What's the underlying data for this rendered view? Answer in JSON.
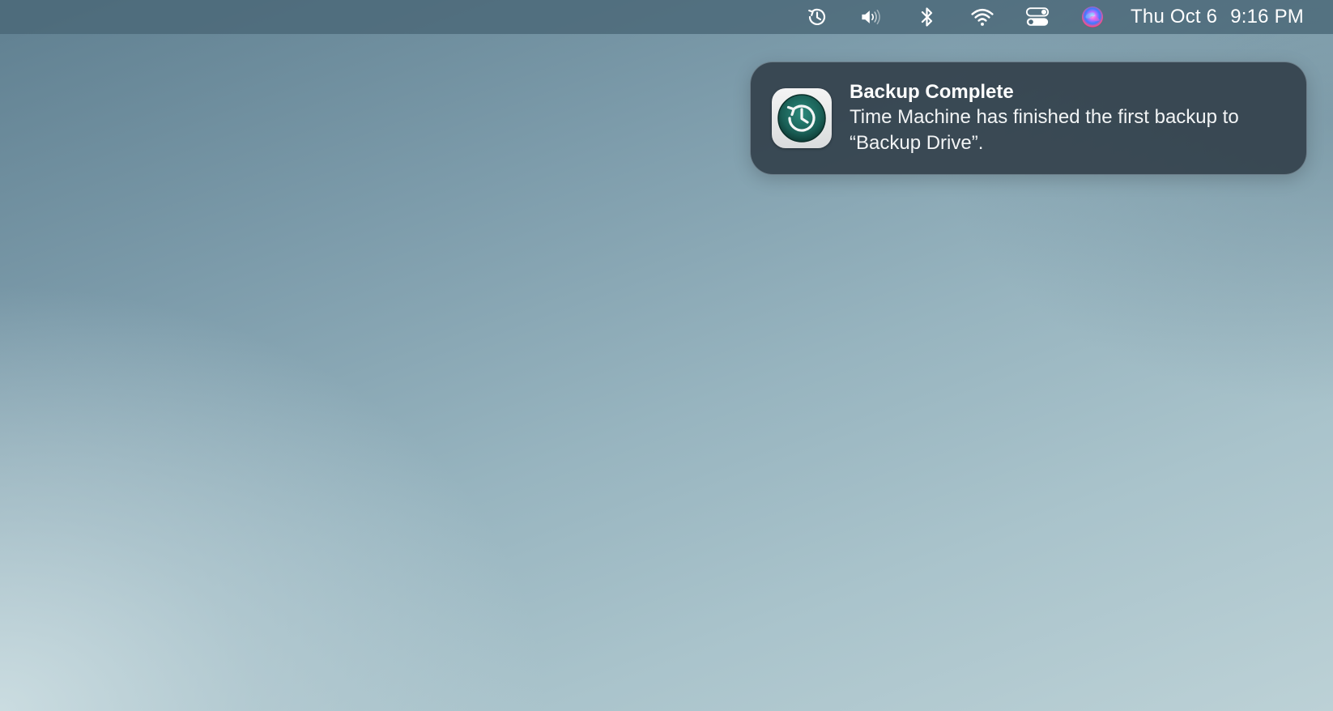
{
  "menubar": {
    "icons": [
      {
        "name": "time-machine-icon"
      },
      {
        "name": "volume-icon"
      },
      {
        "name": "bluetooth-icon"
      },
      {
        "name": "wifi-icon"
      },
      {
        "name": "control-center-icon"
      },
      {
        "name": "siri-icon"
      }
    ],
    "day_date": "Thu Oct 6",
    "time": "9:16 PM"
  },
  "notification": {
    "app_icon": "time-machine-app-icon",
    "title": "Backup Complete",
    "body": "Time Machine has finished the first backup to “Backup Drive”."
  },
  "colors": {
    "menubar_bg": "#4a6878",
    "notification_bg": "#34424c",
    "time_machine_green": "#1f6b61"
  }
}
